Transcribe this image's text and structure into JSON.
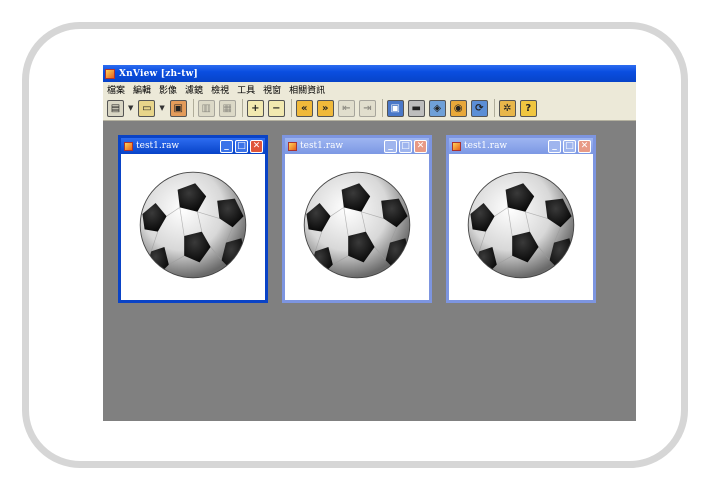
{
  "app": {
    "title": "XnView [zh-tw]"
  },
  "menu": [
    "檔案",
    "編輯",
    "影像",
    "濾鏡",
    "檢視",
    "工具",
    "視窗",
    "相關資訊"
  ],
  "toolbar": {
    "buttons": [
      "browse",
      "open",
      "save",
      "print-preview",
      "slideshow",
      "zoom-in",
      "zoom-out",
      "previous",
      "next",
      "first",
      "last",
      "fullscreen",
      "print",
      "scan",
      "capture",
      "convert",
      "settings",
      "help"
    ],
    "prev_glyph": "«",
    "next_glyph": "»",
    "help_glyph": "?"
  },
  "windows": [
    {
      "title": "test1.raw",
      "active": true
    },
    {
      "title": "test1.raw",
      "active": false
    },
    {
      "title": "test1.raw",
      "active": false
    }
  ],
  "icons": {
    "minimize": "_",
    "maximize": "□",
    "close": "✕"
  },
  "colors": {
    "titlebar_active": "#0a4ee0",
    "titlebar_inactive": "#7c98e4",
    "workspace": "#808080",
    "menubar": "#ece9d8"
  }
}
